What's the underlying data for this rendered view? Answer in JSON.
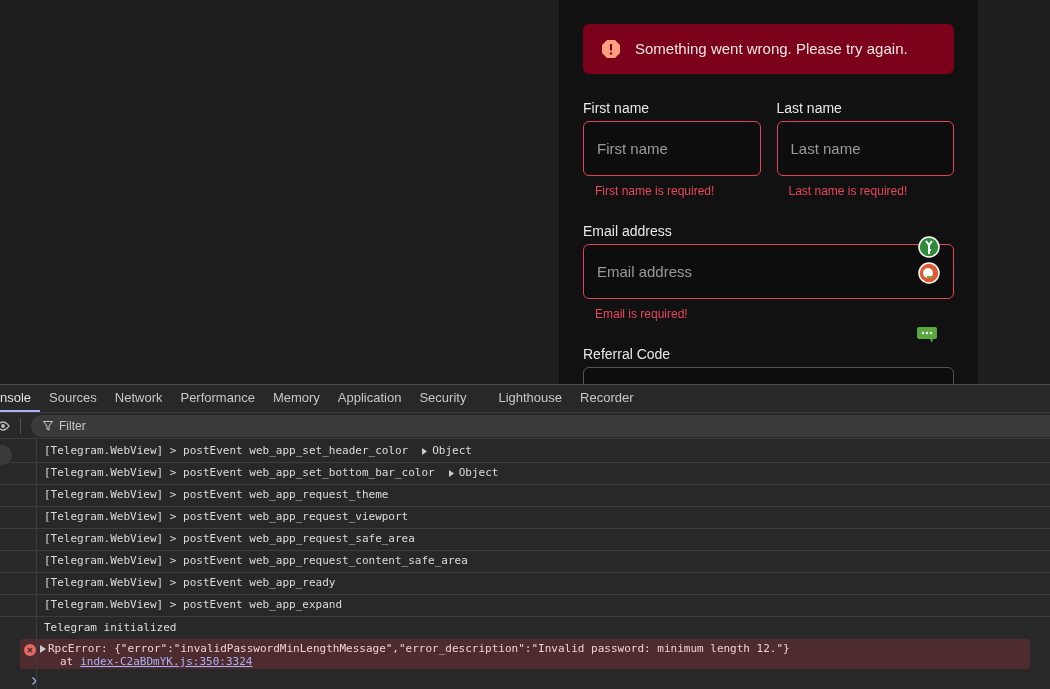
{
  "alert": {
    "text": "Something went wrong. Please try again."
  },
  "name_fields": [
    {
      "label": "First name",
      "placeholder": "First name",
      "error": "First name is required!"
    },
    {
      "label": "Last name",
      "placeholder": "Last name",
      "error": "Last name is required!"
    }
  ],
  "email_field": {
    "label": "Email address",
    "placeholder": "Email address",
    "error": "Email is required!"
  },
  "referral_field": {
    "label": "Referral Code"
  },
  "devtools": {
    "tabs": [
      {
        "label": "nsole",
        "selected": true
      },
      {
        "label": "Sources",
        "selected": false
      },
      {
        "label": "Network",
        "selected": false
      },
      {
        "label": "Performance",
        "selected": false
      },
      {
        "label": "Memory",
        "selected": false
      },
      {
        "label": "Application",
        "selected": false
      },
      {
        "label": "Security",
        "selected": false
      },
      {
        "label": "Lighthouse",
        "selected": false
      },
      {
        "label": "Recorder",
        "selected": false
      }
    ],
    "filter": {
      "placeholder": "Filter"
    },
    "messages": [
      {
        "kind": "log",
        "text": "[Telegram.WebView] > postEvent web_app_set_header_color",
        "arg": "Object"
      },
      {
        "kind": "log",
        "text": "[Telegram.WebView] > postEvent web_app_set_bottom_bar_color",
        "arg": "Object"
      },
      {
        "kind": "log",
        "text": "[Telegram.WebView] > postEvent web_app_request_theme"
      },
      {
        "kind": "log",
        "text": "[Telegram.WebView] > postEvent web_app_request_viewport"
      },
      {
        "kind": "log",
        "text": "[Telegram.WebView] > postEvent web_app_request_safe_area"
      },
      {
        "kind": "log",
        "text": "[Telegram.WebView] > postEvent web_app_request_content_safe_area"
      },
      {
        "kind": "log",
        "text": "[Telegram.WebView] > postEvent web_app_ready"
      },
      {
        "kind": "log",
        "text": "[Telegram.WebView] > postEvent web_app_expand"
      },
      {
        "kind": "plain",
        "text": "Telegram initialized"
      },
      {
        "kind": "error",
        "text": "RpcError: {\"error\":\"invalidPasswordMinLengthMessage\",\"error_description\":\"Invalid password: minimum length 12.\"}",
        "at": "at",
        "link": "index-C2aBDmYK.js:350:3324"
      }
    ]
  }
}
